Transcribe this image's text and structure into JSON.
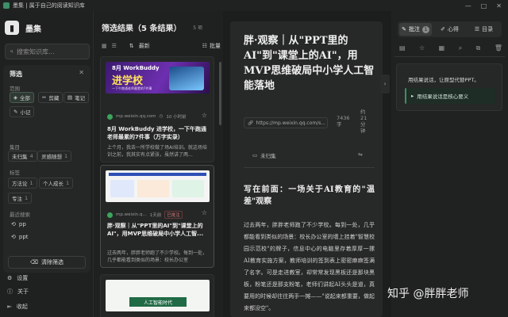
{
  "window": {
    "title": "墨集 | 属于自己的阅读知识库",
    "controls": [
      "—",
      "□",
      "✕"
    ]
  },
  "sidebar": {
    "brand": "墨集",
    "search_placeholder": "搜索知识库...",
    "filter": {
      "title": "筛选",
      "scope_label": "范围",
      "scope_items": [
        "全部",
        "剪藏",
        "笔记",
        "小记"
      ],
      "collection_label": "集目",
      "collection_items": [
        {
          "label": "未归集",
          "count": "4"
        },
        {
          "label": "灵感随想",
          "count": "1"
        }
      ],
      "tags_label": "标签",
      "tag_items": [
        {
          "label": "方法论",
          "count": "1"
        },
        {
          "label": "个人成长",
          "count": "1"
        },
        {
          "label": "专注",
          "count": "1"
        }
      ],
      "recent_label": "最近搜索",
      "recent_items": [
        "pp",
        "ppt"
      ],
      "clear_label": "清除筛选"
    },
    "footer": {
      "settings": "设置",
      "about": "关于",
      "collapse": "收起"
    }
  },
  "results": {
    "title": "筛选结果（5 条结果）",
    "count": "5 项",
    "sort_label": "最新",
    "batch_label": "批量",
    "cards": [
      {
        "thumb_line1": "8月 WorkBuddy",
        "thumb_line2": "进学校",
        "thumb_line3": "一下午跑通老师最累的7件事",
        "source": "mp.weixin.qq.com",
        "time": "10 小时前",
        "title": "8月 WorkBuddy 进学校，一下午跑通老师最累的7件事（万字实录）",
        "excerpt": "上个月，我去一所学校做了场AI培训。就这场培训之前，我其实有点紧张，虽然讲了两..."
      },
      {
        "source": "mp.weixin.q...",
        "time": "1天前",
        "badge": "已批注",
        "title": "胖·观察｜从\"PPT里的AI\"到\"课堂上的AI\"，用MVP思维破局中小学人工智...",
        "excerpt": "过去两年，胖胖老师跑了不少学校。每到一处，几乎都能看到类似的场景：校长办公室"
      },
      {
        "thumb_text": "人工智能时代"
      }
    ]
  },
  "reader": {
    "title": "胖·观察｜从\"PPT里的AI\"到\"课堂上的AI\"，用MVP思维破局中小学人工智能落地",
    "url": "https://mp.weixin.qq.com/s...",
    "word_count_value": "7436",
    "word_count_unit": "字",
    "read_time_line1": "约",
    "read_time_line2": "21",
    "read_time_line3": "分",
    "read_time_line4": "钟",
    "status": "未归集",
    "subheading": "写在前面：一场关于AI教育的\"温差\"观察",
    "body": "过去两年，胖胖老师跑了不少学校。每到一处，几乎都能看到类似的场景：校长办公室的墙上挂着\"智慧校园示范校\"的牌子，信息中心的电脑里存着厚厚一摞AI教育实施方案，教师培训的签到表上密密麻麻签满了名字。可是走进教室，却常常发现黑板还是那块黑板，粉笔还是那支粉笔，老师们讲起AI头头是道，真要用的时候却往往两手一摊——\"说起来都重要，做起来都没空\"。"
  },
  "panel": {
    "tabs": [
      {
        "label": "批注",
        "count": "1"
      },
      {
        "label": "心得"
      },
      {
        "label": "目录"
      }
    ],
    "note_text": "用结果说话，让原型代替PPT。",
    "note_quote": "用结果说话是核心要义"
  },
  "watermark": "知乎 @胖胖老师"
}
